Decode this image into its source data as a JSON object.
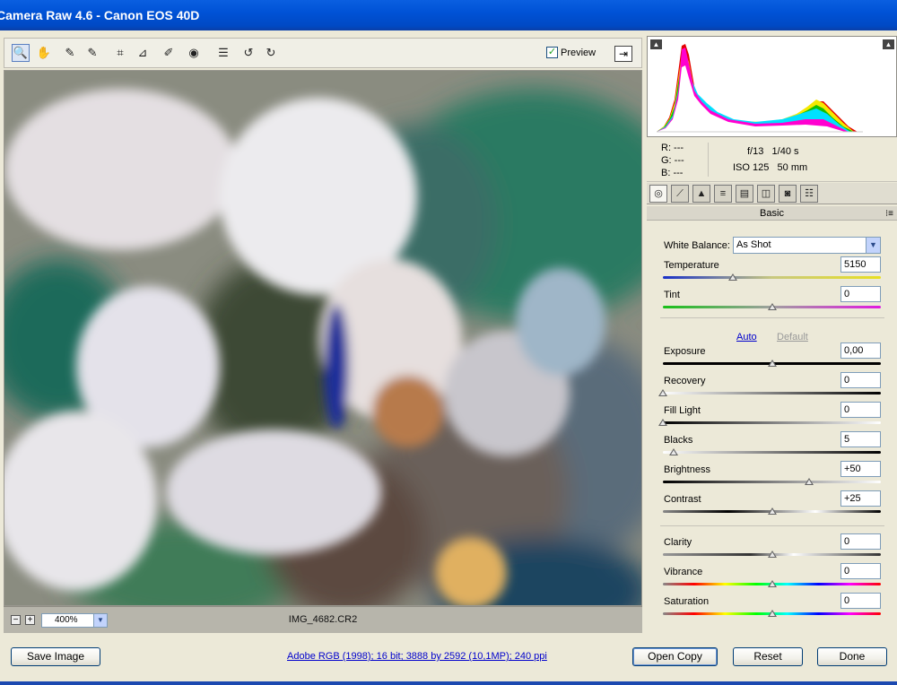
{
  "window": {
    "title": "Camera Raw 4.6  -  Canon EOS 40D"
  },
  "toolbar": {
    "tools": [
      {
        "name": "zoom-tool-icon",
        "glyph": "🔍",
        "selected": true
      },
      {
        "name": "hand-tool-icon",
        "glyph": "✋"
      },
      {
        "name": "white-balance-tool-icon",
        "glyph": "✎"
      },
      {
        "name": "color-sampler-tool-icon",
        "glyph": "✎"
      },
      {
        "name": "crop-tool-icon",
        "glyph": "⌗"
      },
      {
        "name": "straighten-tool-icon",
        "glyph": "⊿"
      },
      {
        "name": "retouch-tool-icon",
        "glyph": "✐"
      },
      {
        "name": "red-eye-tool-icon",
        "glyph": "◉"
      },
      {
        "name": "preferences-icon",
        "glyph": "☰"
      },
      {
        "name": "rotate-ccw-icon",
        "glyph": "↺"
      },
      {
        "name": "rotate-cw-icon",
        "glyph": "↻"
      }
    ],
    "preview_label": "Preview",
    "preview_checked": true
  },
  "status": {
    "zoom": "400%",
    "filename": "IMG_4682.CR2"
  },
  "readout": {
    "r": "R:  ---",
    "g": "G:  ---",
    "b": "B:  ---",
    "aperture": "f/13",
    "shutter": "1/40 s",
    "iso": "ISO 125",
    "focal": "50 mm"
  },
  "panel": {
    "section_title": "Basic"
  },
  "basic": {
    "white_balance_label": "White Balance:",
    "white_balance_value": "As Shot",
    "auto_label": "Auto",
    "default_label": "Default",
    "sliders": [
      {
        "key": "temperature",
        "label": "Temperature",
        "value": "5150",
        "pos": 0.32
      },
      {
        "key": "tint",
        "label": "Tint",
        "value": "0",
        "pos": 0.5
      },
      {
        "key": "exposure",
        "label": "Exposure",
        "value": "0,00",
        "pos": 0.5
      },
      {
        "key": "recovery",
        "label": "Recovery",
        "value": "0",
        "pos": 0.0
      },
      {
        "key": "fill-light",
        "label": "Fill Light",
        "value": "0",
        "pos": 0.0
      },
      {
        "key": "blacks",
        "label": "Blacks",
        "value": "5",
        "pos": 0.05
      },
      {
        "key": "brightness",
        "label": "Brightness",
        "value": "+50",
        "pos": 0.67
      },
      {
        "key": "contrast",
        "label": "Contrast",
        "value": "+25",
        "pos": 0.5
      },
      {
        "key": "clarity",
        "label": "Clarity",
        "value": "0",
        "pos": 0.5
      },
      {
        "key": "vibrance",
        "label": "Vibrance",
        "value": "0",
        "pos": 0.5
      },
      {
        "key": "saturation",
        "label": "Saturation",
        "value": "0",
        "pos": 0.5
      }
    ]
  },
  "footer": {
    "save_label": "Save Image",
    "workflow_link": "Adobe RGB (1998); 16 bit; 3888 by 2592 (10,1MP); 240 ppi",
    "open_label": "Open Copy",
    "reset_label": "Reset",
    "done_label": "Done"
  },
  "colors": {
    "accent": "#0054e3",
    "link": "#0000cc"
  }
}
